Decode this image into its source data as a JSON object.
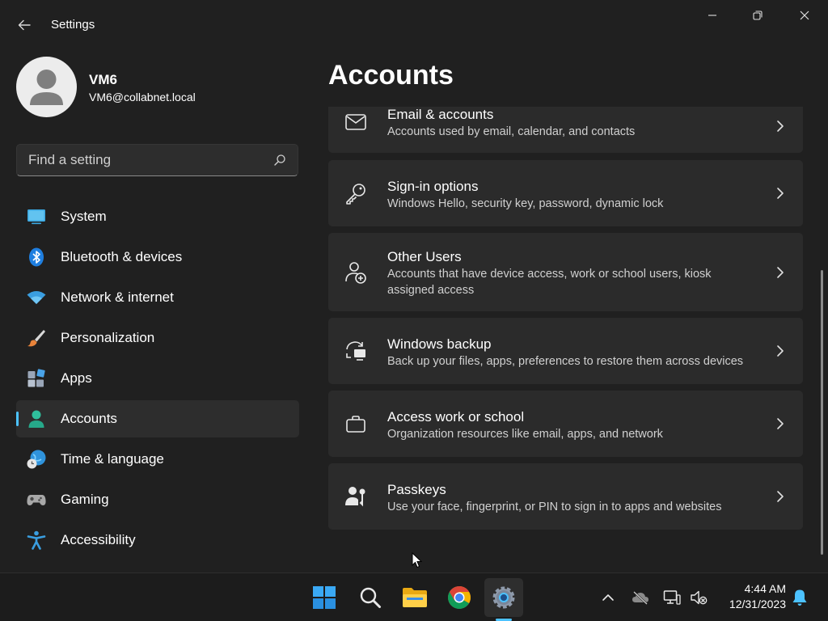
{
  "window": {
    "title": "Settings"
  },
  "profile": {
    "name": "VM6",
    "email": "VM6@collabnet.local"
  },
  "search": {
    "placeholder": "Find a setting"
  },
  "sidebar": {
    "items": [
      {
        "label": "System",
        "icon": "monitor-icon"
      },
      {
        "label": "Bluetooth & devices",
        "icon": "bluetooth-icon"
      },
      {
        "label": "Network & internet",
        "icon": "wifi-icon"
      },
      {
        "label": "Personalization",
        "icon": "brush-icon"
      },
      {
        "label": "Apps",
        "icon": "apps-icon"
      },
      {
        "label": "Accounts",
        "icon": "account-icon",
        "active": true
      },
      {
        "label": "Time & language",
        "icon": "globe-clock-icon"
      },
      {
        "label": "Gaming",
        "icon": "gamepad-icon"
      },
      {
        "label": "Accessibility",
        "icon": "accessibility-icon"
      }
    ]
  },
  "main": {
    "title": "Accounts",
    "cards": [
      {
        "title": "Email & accounts",
        "description": "Accounts used by email, calendar, and contacts",
        "icon": "mail-icon"
      },
      {
        "title": "Sign-in options",
        "description": "Windows Hello, security key, password, dynamic lock",
        "icon": "key-icon"
      },
      {
        "title": "Other Users",
        "description": "Accounts that have device access, work or school users, kiosk assigned access",
        "icon": "add-user-icon"
      },
      {
        "title": "Windows backup",
        "description": "Back up your files, apps, preferences to restore them across devices",
        "icon": "backup-icon"
      },
      {
        "title": "Access work or school",
        "description": "Organization resources like email, apps, and network",
        "icon": "briefcase-icon"
      },
      {
        "title": "Passkeys",
        "description": "Use your face, fingerprint, or PIN to sign in to apps and websites",
        "icon": "passkey-icon"
      }
    ]
  },
  "taskbar": {
    "apps": [
      "start-icon",
      "search-icon",
      "file-explorer-icon",
      "chrome-icon",
      "settings-icon"
    ],
    "time": "4:44 AM",
    "date": "12/31/2023"
  },
  "colors": {
    "accent": "#4cc2ff",
    "background": "#202020",
    "card": "#2b2b2b"
  }
}
